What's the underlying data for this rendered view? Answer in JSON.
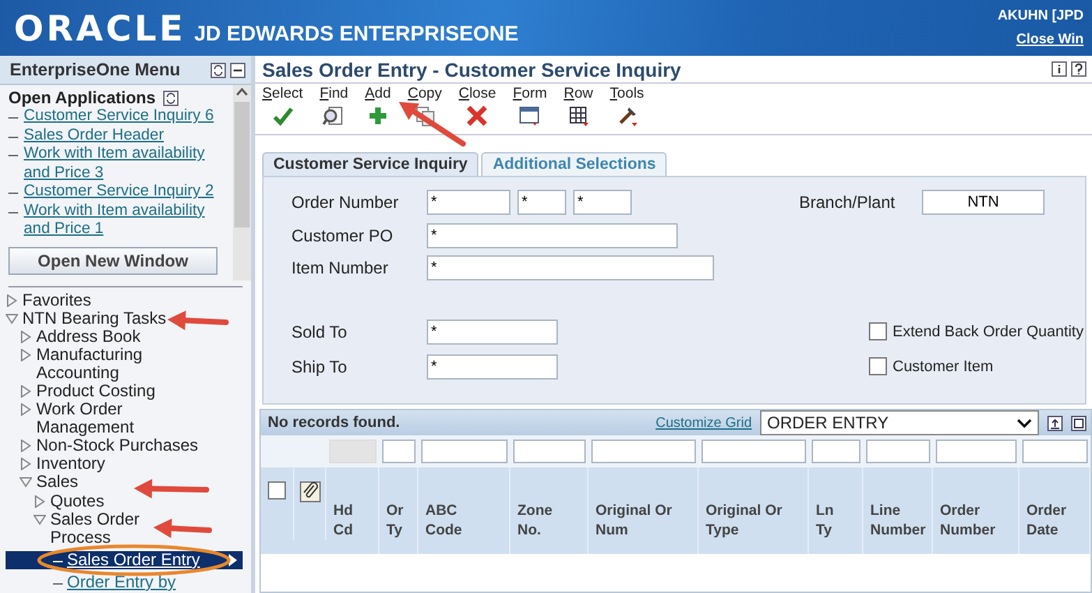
{
  "header": {
    "logo": "ORACLE",
    "product": "JD EDWARDS ENTERPRISEONE",
    "user": "AKUHN [JPD",
    "close_link": "Close Win"
  },
  "sidebar": {
    "title": "EnterpriseOne Menu",
    "open_applications": {
      "title": "Open Applications",
      "items": [
        "Customer Service Inquiry 6",
        "Sales Order Header",
        "Work with Item availability and Price 3",
        "Customer Service Inquiry 2",
        "Work with Item availability and Price 1"
      ],
      "button": "Open New Window"
    },
    "tree": [
      {
        "label": "Favorites",
        "kind": "folder",
        "expanded": false,
        "selected": false
      },
      {
        "label": "NTN Bearing Tasks",
        "kind": "folder",
        "expanded": true,
        "selected": false,
        "children": [
          {
            "label": "Address Book",
            "kind": "folder",
            "expanded": false,
            "selected": false
          },
          {
            "label": "Manufacturing Accounting",
            "kind": "folder",
            "expanded": false,
            "selected": false
          },
          {
            "label": "Product Costing",
            "kind": "folder",
            "expanded": false,
            "selected": false
          },
          {
            "label": "Work Order Management",
            "kind": "folder",
            "expanded": false,
            "selected": false
          },
          {
            "label": "Non-Stock Purchases",
            "kind": "folder",
            "expanded": false,
            "selected": false
          },
          {
            "label": "Inventory",
            "kind": "folder",
            "expanded": false,
            "selected": false
          },
          {
            "label": "Sales",
            "kind": "folder",
            "expanded": true,
            "selected": false,
            "children": [
              {
                "label": "Quotes",
                "kind": "folder",
                "expanded": false,
                "selected": false
              },
              {
                "label": "Sales Order Process",
                "kind": "folder",
                "expanded": true,
                "selected": false,
                "children": [
                  {
                    "label": "Sales Order Entry",
                    "kind": "task",
                    "selected": true
                  },
                  {
                    "label": "Order Entry by",
                    "kind": "task",
                    "selected": false
                  }
                ]
              }
            ]
          }
        ]
      }
    ]
  },
  "main": {
    "title": "Sales Order Entry - Customer Service Inquiry",
    "toolbar": [
      {
        "label": "Select",
        "kind": "check"
      },
      {
        "label": "Find",
        "kind": "find"
      },
      {
        "label": "Add",
        "kind": "add"
      },
      {
        "label": "Copy",
        "kind": "copy"
      },
      {
        "label": "Close",
        "kind": "close"
      },
      {
        "label": "Form",
        "kind": "form"
      },
      {
        "label": "Row",
        "kind": "row"
      },
      {
        "label": "Tools",
        "kind": "tools"
      }
    ],
    "tabs": [
      {
        "label": "Customer Service Inquiry",
        "selected": true
      },
      {
        "label": "Additional Selections",
        "selected": false
      }
    ],
    "form": {
      "order_number": {
        "label": "Order Number",
        "values": [
          "*",
          "*",
          "*"
        ]
      },
      "branch_plant": {
        "label": "Branch/Plant",
        "value": "NTN"
      },
      "customer_po": {
        "label": "Customer PO",
        "value": "*"
      },
      "item_number": {
        "label": "Item Number",
        "value": "*"
      },
      "sold_to": {
        "label": "Sold To",
        "value": "*"
      },
      "ship_to": {
        "label": "Ship To",
        "value": "*"
      },
      "options": [
        {
          "label": "Extend Back Order Quantity",
          "checked": false
        },
        {
          "label": "Customer Item",
          "checked": false
        }
      ]
    },
    "grid": {
      "status": "No records found.",
      "customize_link": "Customize Grid",
      "view": "ORDER ENTRY",
      "columns": [
        {
          "label": "Hd Cd",
          "filter_disabled": true
        },
        {
          "label": "Or Ty",
          "filter_disabled": false
        },
        {
          "label": "ABC Code",
          "filter_disabled": false
        },
        {
          "label": "Zone No.",
          "filter_disabled": false
        },
        {
          "label": "Original Or Num",
          "filter_disabled": false
        },
        {
          "label": "Original Or Type",
          "filter_disabled": false
        },
        {
          "label": "Ln Ty",
          "filter_disabled": false
        },
        {
          "label": "Line Number",
          "filter_disabled": false
        },
        {
          "label": "Order Number",
          "filter_disabled": false
        },
        {
          "label": "Order Date",
          "filter_disabled": false
        }
      ],
      "select_all_checked": false
    }
  }
}
